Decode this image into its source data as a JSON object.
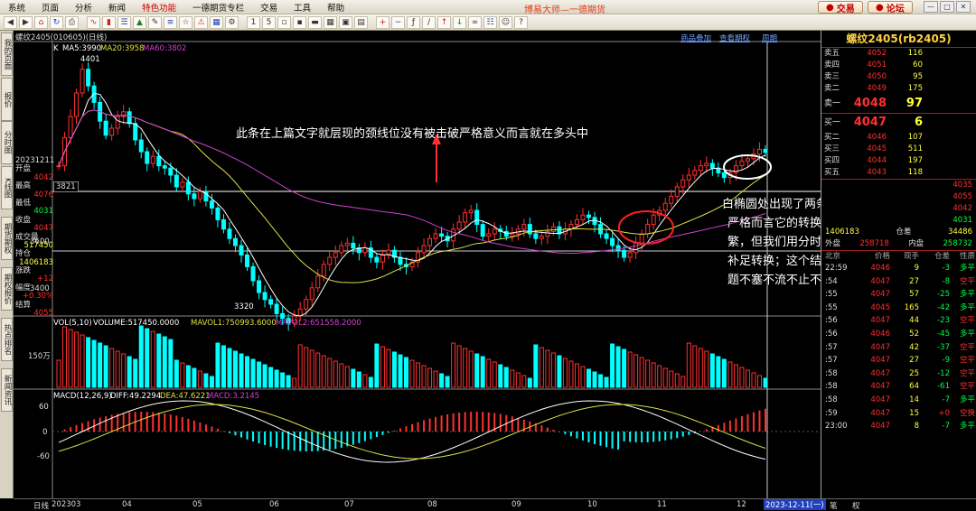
{
  "menu": {
    "items": [
      "系统",
      "页面",
      "分析",
      "新闻",
      "特色功能",
      "一德期货专栏",
      "交易",
      "工具",
      "帮助"
    ],
    "active_index": 4,
    "app_title": "博易大师—一德期货",
    "trade_button": "交易",
    "forum_button": "论坛"
  },
  "side_tabs": [
    "我的页面",
    "报价",
    "分时图",
    "K线图",
    "期货期权",
    "期权报价",
    "热点排名",
    "新闻资讯"
  ],
  "chart": {
    "symbol_header": "螺纹2405(010605)(日线)",
    "k_label": "K",
    "ma5": "MA5:3990",
    "ma20": "MA20:3958",
    "ma60": "MA60:3802",
    "links": [
      "商品叠加",
      "查看期权",
      "周期"
    ],
    "high_label": "4401",
    "low_label": "3320",
    "cursor_price": "3821",
    "price_ticks": [
      "3600",
      "3400"
    ],
    "vol_header": "VOL(5,10)",
    "vol_values": "VOLUME:517450.0000",
    "mavol1": "MAVOL1:750993.6000",
    "mavol2": "MAVOL2:651558.2000",
    "vol_tick": "150万",
    "macd_header": "MACD(12,26,9)",
    "diff": "DIFF:49.2294",
    "dea": "DEA:47.6221",
    "macd": "MACD:3.2145",
    "macd_ticks": [
      "60",
      "0",
      "-60"
    ],
    "period_label": "日线",
    "months": [
      "202303",
      "04",
      "05",
      "06",
      "07",
      "08",
      "09",
      "10",
      "11",
      "12"
    ],
    "date_box": "2023-12-11(一)",
    "annotation_top": "此条在上篇文字就层现的颈线位没有被击破严格意义而言就在多头中",
    "annotation_right": [
      "白椭圆处出现了两条均线的死与多的交叉",
      "严格而言它的转换多空在本周是相对了频",
      "繁，但我们用分时的多空给予了它的提前",
      "补足转换；这个结构完美了我们今天的主",
      "题不塞不流不止不行"
    ],
    "colors": {
      "up": "#ff3030",
      "down": "#00ffff",
      "ma5": "#ffffff",
      "ma20": "#e0e040",
      "ma60": "#d040d0",
      "annotation": "#ffffff"
    }
  },
  "quote_left": [
    {
      "label": "20231211",
      "value": ""
    },
    {
      "label": "开盘",
      "value": "4042"
    },
    {
      "label": "最高",
      "value": "4076"
    },
    {
      "label": "最低",
      "value": "4031"
    },
    {
      "label": "收盘",
      "value": "4047"
    },
    {
      "label": "成交量",
      "value": "517450"
    },
    {
      "label": "持仓",
      "value": "1406183"
    },
    {
      "label": "涨跌",
      "value": "+12"
    },
    {
      "label": "幅度",
      "value": "+0.30%"
    },
    {
      "label": "结算",
      "value": "4055"
    }
  ],
  "right_panel": {
    "title": "螺纹2405(rb2405)",
    "asks": [
      {
        "label": "卖五",
        "price": "4052",
        "vol": "116"
      },
      {
        "label": "卖四",
        "price": "4051",
        "vol": "60"
      },
      {
        "label": "卖三",
        "price": "4050",
        "vol": "95"
      },
      {
        "label": "卖二",
        "price": "4049",
        "vol": "175"
      },
      {
        "label": "卖一",
        "price": "4048",
        "vol": "97"
      }
    ],
    "bids": [
      {
        "label": "买一",
        "price": "4047",
        "vol": "6"
      },
      {
        "label": "买二",
        "price": "4046",
        "vol": "107"
      },
      {
        "label": "买三",
        "price": "4045",
        "vol": "511"
      },
      {
        "label": "买四",
        "price": "4044",
        "vol": "197"
      },
      {
        "label": "买五",
        "price": "4043",
        "vol": "118"
      }
    ],
    "partial_stats": [
      {
        "label": "",
        "value": "4035"
      },
      {
        "label": "",
        "value": "4055"
      },
      {
        "label": "",
        "value": "4042"
      },
      {
        "label": "",
        "value": "4031"
      }
    ],
    "oi_row": {
      "v1": "1406183",
      "label": "仓差",
      "v2": "34486"
    },
    "outer_row": {
      "label1": "外盘",
      "v1": "258718",
      "label2": "内盘",
      "v2": "258732"
    },
    "tick_header": [
      "北京",
      "价格",
      "现手",
      "仓差",
      "性质"
    ],
    "ticks": [
      {
        "t": "22:59",
        "p": "4046",
        "q": "9",
        "d": "-3",
        "n": "多平"
      },
      {
        "t": ":54",
        "p": "4047",
        "q": "27",
        "d": "-8",
        "n": "空平"
      },
      {
        "t": ":55",
        "p": "4047",
        "q": "57",
        "d": "-25",
        "n": "多平"
      },
      {
        "t": ":55",
        "p": "4045",
        "q": "165",
        "d": "-42",
        "n": "多平"
      },
      {
        "t": ":56",
        "p": "4047",
        "q": "44",
        "d": "-23",
        "n": "空平"
      },
      {
        "t": ":56",
        "p": "4046",
        "q": "52",
        "d": "-45",
        "n": "多平"
      },
      {
        "t": ":57",
        "p": "4047",
        "q": "42",
        "d": "-37",
        "n": "空平"
      },
      {
        "t": ":57",
        "p": "4047",
        "q": "27",
        "d": "-9",
        "n": "空平"
      },
      {
        "t": ":58",
        "p": "4047",
        "q": "25",
        "d": "-12",
        "n": "空平"
      },
      {
        "t": ":58",
        "p": "4047",
        "q": "64",
        "d": "-61",
        "n": "空平"
      },
      {
        "t": ":58",
        "p": "4047",
        "q": "14",
        "d": "-7",
        "n": "多平"
      },
      {
        "t": ":59",
        "p": "4047",
        "q": "15",
        "d": "+0",
        "n": "空换"
      },
      {
        "t": "23:00",
        "p": "4047",
        "q": "8",
        "d": "-7",
        "n": "多平"
      }
    ],
    "bottom_tabs": [
      "笔",
      "权"
    ]
  }
}
